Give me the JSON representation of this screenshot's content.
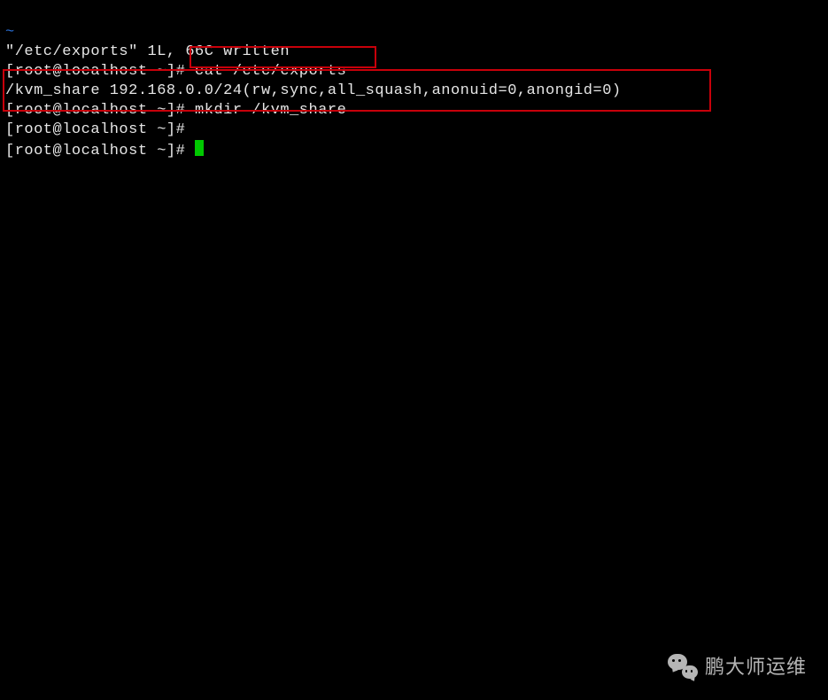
{
  "vim_tilde": "~",
  "vim_msg": "\"/etc/exports\" 1L, 66C written",
  "prompt": "[root@localhost ~]# ",
  "cmd1": "cat /etc/exports",
  "exports_content": "/kvm_share 192.168.0.0/24(rw,sync,all_squash,anonuid=0,anongid=0)",
  "cmd2": "mkdir /kvm_share",
  "watermark_text": "鹏大师运维"
}
